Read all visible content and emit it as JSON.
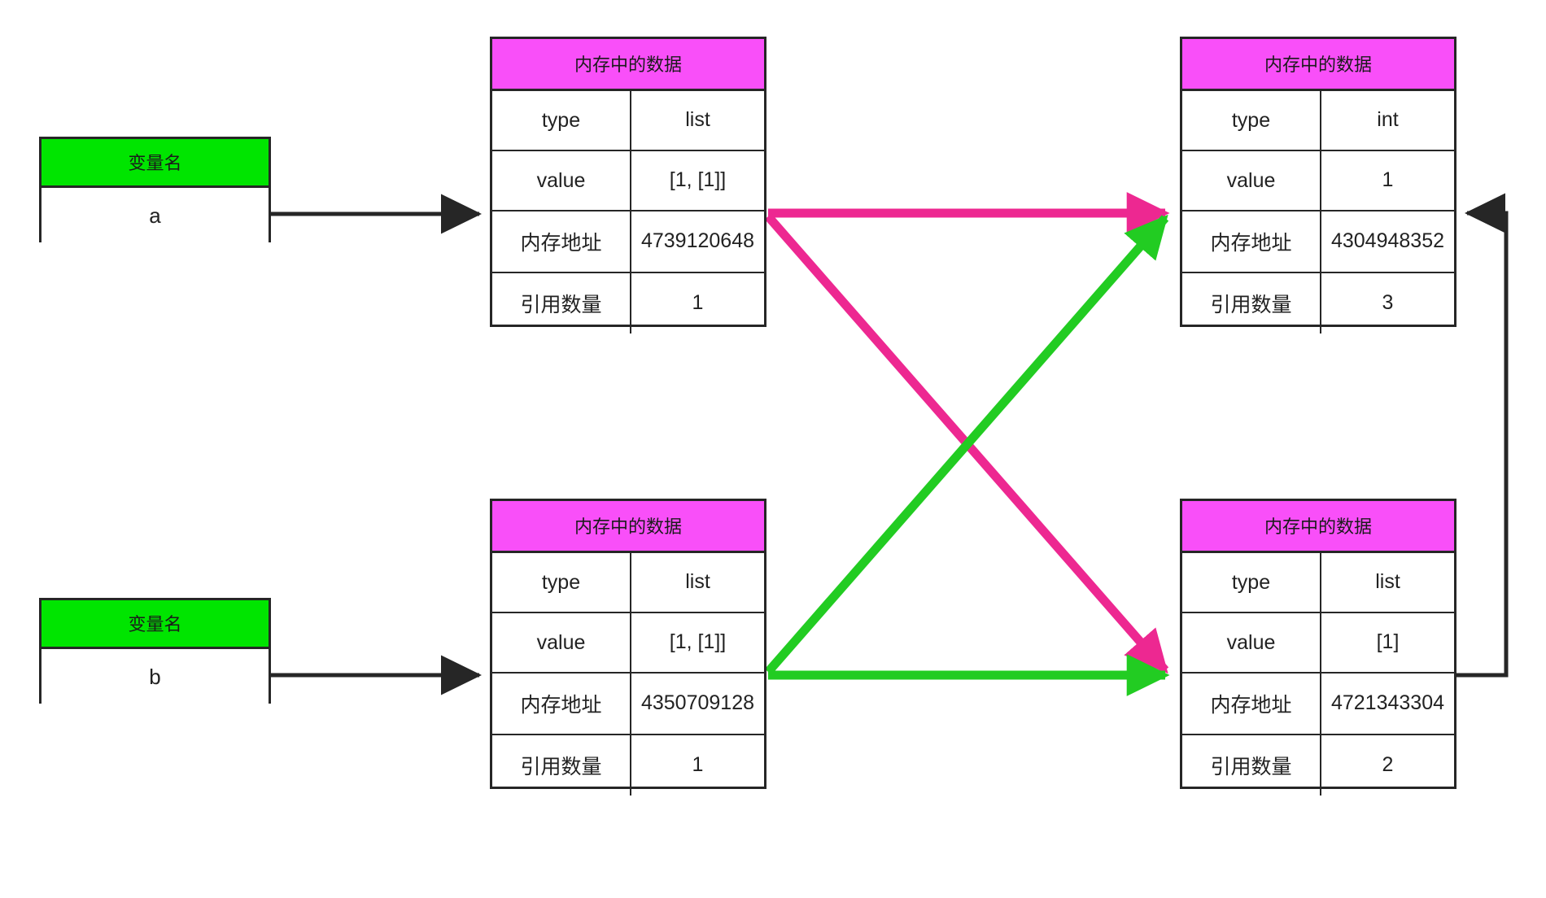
{
  "title": "Python variable / memory reference diagram",
  "colors": {
    "variable_header_green": "#00e500",
    "memory_header_magenta": "#f94ff9",
    "arrow_pink": "#ed2891",
    "arrow_green": "#22cc22",
    "arrow_black": "#262626",
    "border": "#262626",
    "background": "#ffffff"
  },
  "labels": {
    "variable_header": "变量名",
    "memory_header": "内存中的数据",
    "key_type": "type",
    "key_value": "value",
    "key_address": "内存地址",
    "key_refcount": "引用数量"
  },
  "variables": [
    {
      "id": "var-a",
      "header": "变量名",
      "name": "a"
    },
    {
      "id": "var-b",
      "header": "变量名",
      "name": "b"
    }
  ],
  "memory_blocks": [
    {
      "id": "mem-top-left",
      "header": "内存中的数据",
      "rows": [
        {
          "key": "type",
          "value": "list"
        },
        {
          "key": "value",
          "value": "[1, [1]]"
        },
        {
          "key": "内存地址",
          "value": "4739120648"
        },
        {
          "key": "引用数量",
          "value": "1"
        }
      ]
    },
    {
      "id": "mem-top-right",
      "header": "内存中的数据",
      "rows": [
        {
          "key": "type",
          "value": "int"
        },
        {
          "key": "value",
          "value": "1"
        },
        {
          "key": "内存地址",
          "value": "4304948352"
        },
        {
          "key": "引用数量",
          "value": "3"
        }
      ]
    },
    {
      "id": "mem-bottom-left",
      "header": "内存中的数据",
      "rows": [
        {
          "key": "type",
          "value": "list"
        },
        {
          "key": "value",
          "value": "[1, [1]]"
        },
        {
          "key": "内存地址",
          "value": "4350709128"
        },
        {
          "key": "引用数量",
          "value": "1"
        }
      ]
    },
    {
      "id": "mem-bottom-right",
      "header": "内存中的数据",
      "rows": [
        {
          "key": "type",
          "value": "list"
        },
        {
          "key": "value",
          "value": "[1]"
        },
        {
          "key": "内存地址",
          "value": "4721343304"
        },
        {
          "key": "引用数量",
          "value": "2"
        }
      ]
    }
  ],
  "arrows": [
    {
      "id": "arrow-a-to-top-left",
      "color": "#262626",
      "style": "straight",
      "from": "var-a value",
      "to": "mem-top-left value"
    },
    {
      "id": "arrow-b-to-bottom-left",
      "color": "#262626",
      "style": "straight",
      "from": "var-b value",
      "to": "mem-bottom-left value"
    },
    {
      "id": "arrow-topleft-to-topright",
      "color": "#ed2891",
      "style": "straight",
      "from": "mem-top-left value",
      "to": "mem-top-right value"
    },
    {
      "id": "arrow-topleft-to-bottomright",
      "color": "#ed2891",
      "style": "diagonal",
      "from": "mem-top-left value",
      "to": "mem-bottom-right value"
    },
    {
      "id": "arrow-bottomleft-to-bottomright",
      "color": "#22cc22",
      "style": "straight",
      "from": "mem-bottom-left value",
      "to": "mem-bottom-right value"
    },
    {
      "id": "arrow-bottomleft-to-topright",
      "color": "#22cc22",
      "style": "diagonal",
      "from": "mem-bottom-left value",
      "to": "mem-top-right value"
    },
    {
      "id": "arrow-bottomright-to-topright",
      "color": "#262626",
      "style": "orthogonal",
      "from": "mem-bottom-right value",
      "to": "mem-top-right value"
    }
  ]
}
